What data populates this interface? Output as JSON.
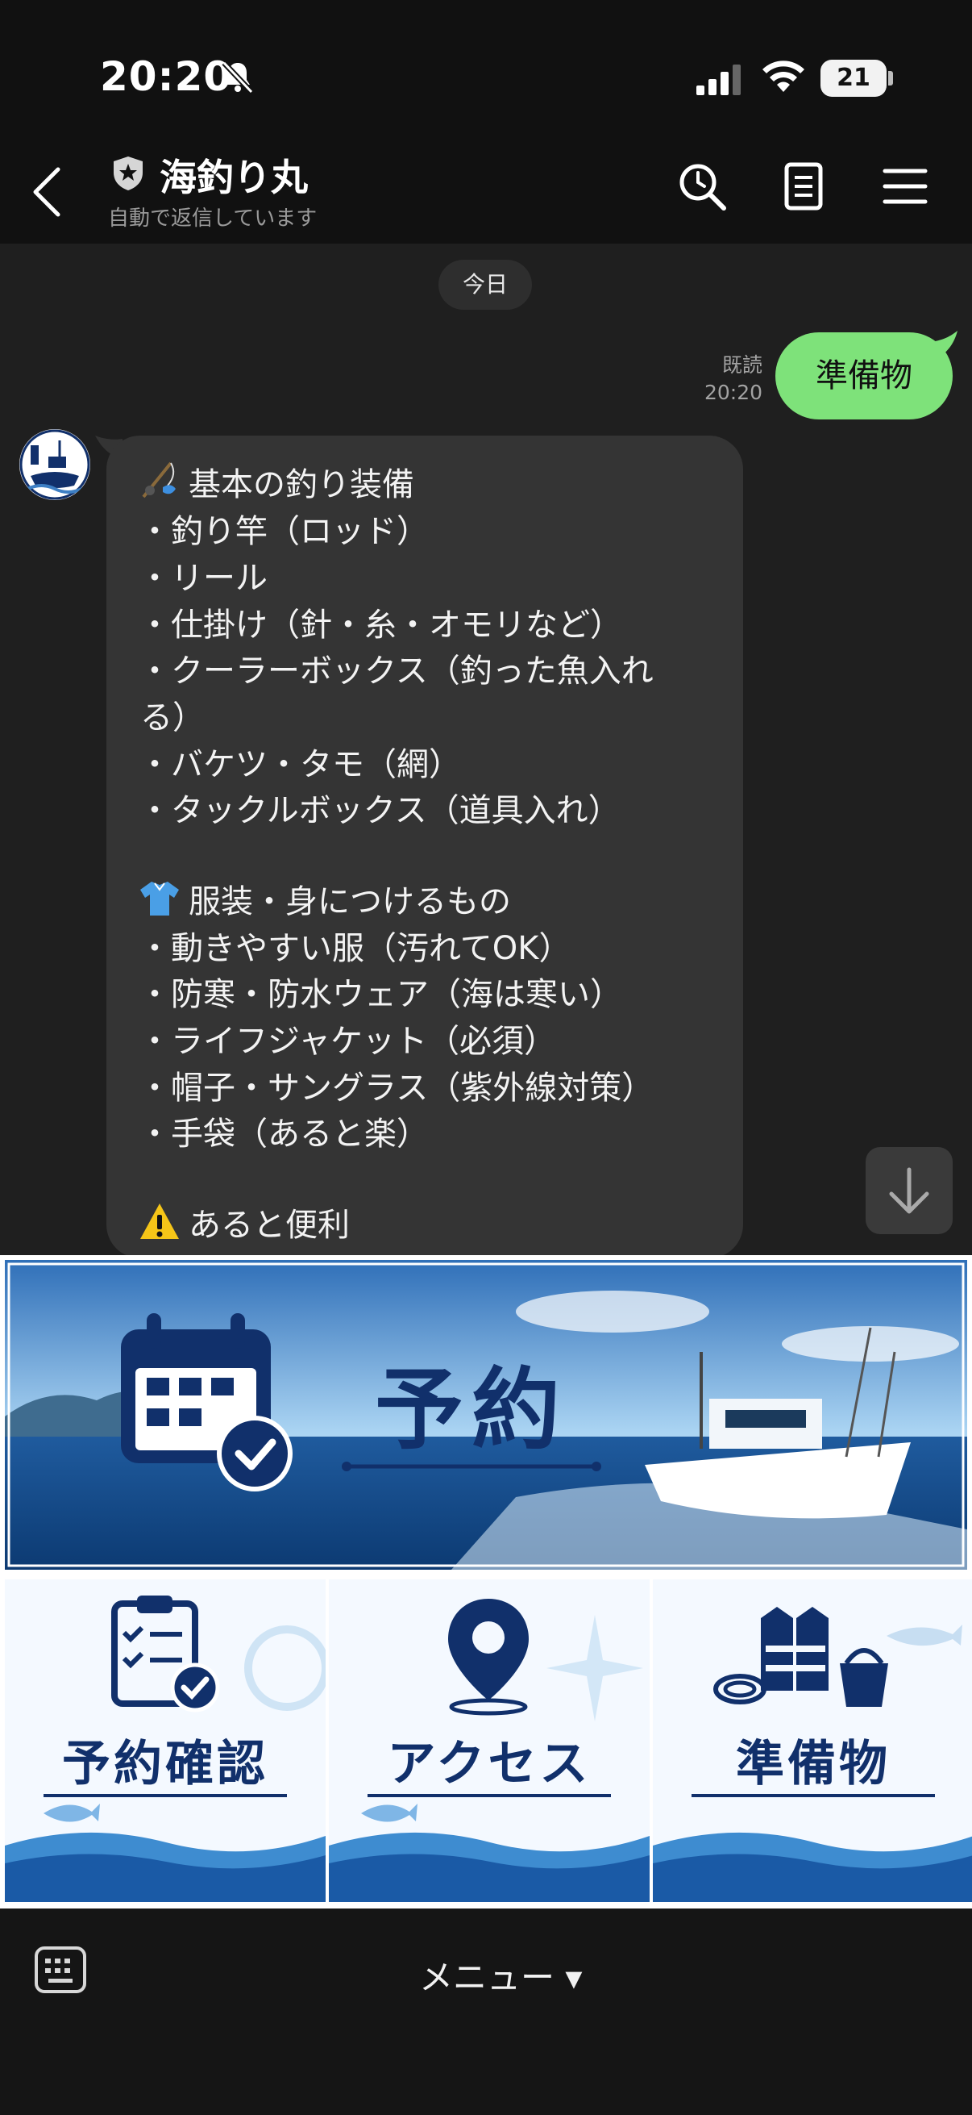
{
  "status": {
    "time": "20:20",
    "battery": "21"
  },
  "header": {
    "title": "海釣り丸",
    "subtitle": "自動で返信しています"
  },
  "chat": {
    "date_label": "今日",
    "sent_message": {
      "text": "準備物",
      "read_label": "既読",
      "time": "20:20"
    },
    "received_lines": [
      {
        "emoji": "fishing-pole",
        "text": "基本の釣り装備"
      },
      {
        "text": "・釣り竿（ロッド）"
      },
      {
        "text": "・リール"
      },
      {
        "text": "・仕掛け（針・糸・オモリなど）"
      },
      {
        "text": "・クーラーボックス（釣った魚入れ"
      },
      {
        "text": "る）"
      },
      {
        "text": "・バケツ・タモ（網）"
      },
      {
        "text": "・タックルボックス（道具入れ）"
      },
      {
        "text": ""
      },
      {
        "emoji": "t-shirt",
        "text": "服装・身につけるもの"
      },
      {
        "text": "・動きやすい服（汚れてOK）"
      },
      {
        "text": "・防寒・防水ウェア（海は寒い）"
      },
      {
        "text": "・ライフジャケット（必須）"
      },
      {
        "text": "・帽子・サングラス（紫外線対策）"
      },
      {
        "text": "・手袋（あると楽）"
      },
      {
        "text": ""
      },
      {
        "emoji": "warning",
        "text": "あると便利"
      }
    ]
  },
  "rich_menu": {
    "banner_label": "予約",
    "tiles": [
      {
        "label": "予約確認",
        "icon": "clipboard-check-icon"
      },
      {
        "label": "アクセス",
        "icon": "map-pin-icon"
      },
      {
        "label": "準備物",
        "icon": "life-jacket-icon"
      }
    ]
  },
  "bottom_bar": {
    "menu_label": "メニュー ▾"
  },
  "colors": {
    "sent_bubble": "#7ee27a",
    "received_bubble": "#343434",
    "navy": "#11306b"
  }
}
